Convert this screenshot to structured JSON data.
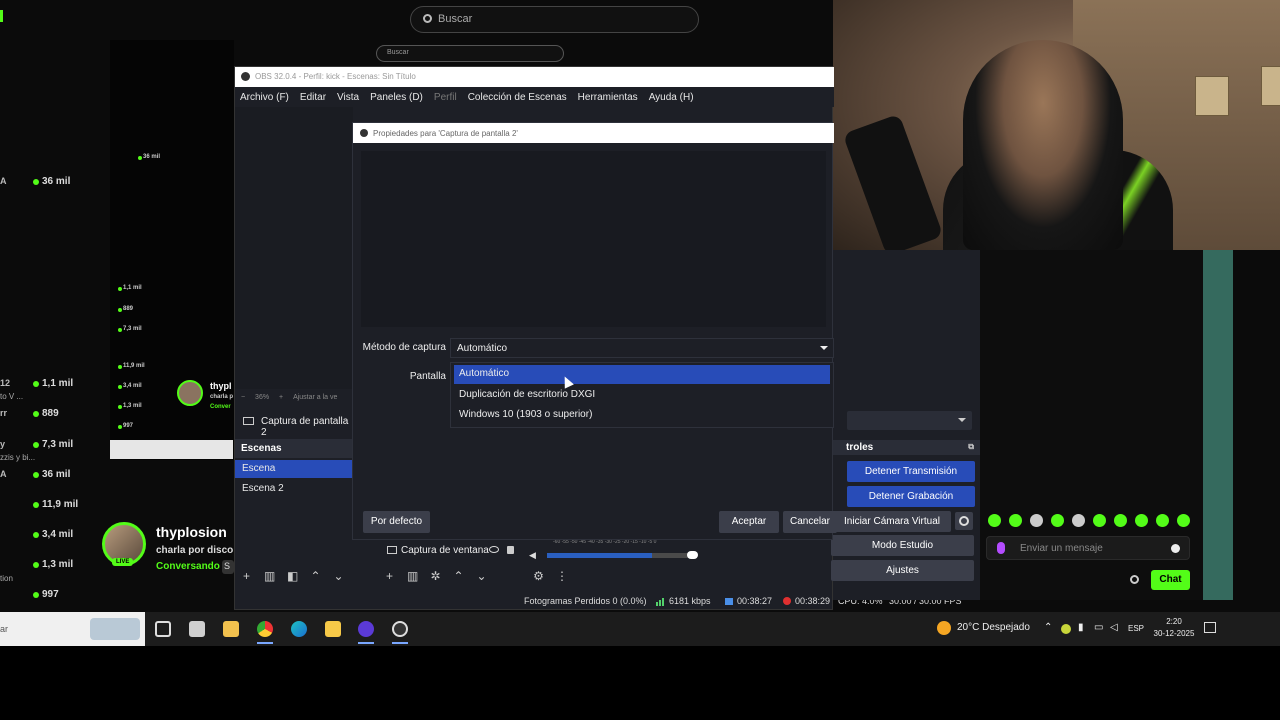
{
  "kick": {
    "search_placeholder": "Buscar",
    "search_placeholder_small": "Buscar",
    "viewers": [
      {
        "prefix": "A",
        "value": "36 mil"
      },
      {
        "prefix": "12",
        "value": "1,1 mil"
      },
      {
        "prefix": "rr",
        "value": "889"
      },
      {
        "prefix": "y",
        "value": "7,3 mil"
      },
      {
        "prefix": "A",
        "value": "36 mil"
      },
      {
        "prefix": "",
        "value": "11,9 mil"
      },
      {
        "prefix": "",
        "value": "3,4 mil"
      },
      {
        "prefix": "",
        "value": "1,3 mil"
      },
      {
        "prefix": "",
        "value": "997"
      }
    ],
    "viewer_side_labels": [
      "to V ...",
      "zzis y bi...",
      "tion"
    ],
    "mini_counts": [
      "36 mil",
      "1,1 mil",
      "889",
      "7,3 mil",
      "11,9 mil",
      "3,4 mil",
      "1,3 mil",
      "997"
    ],
    "mini_name": "thypl",
    "mini_sub": "charla p",
    "mini_status": "Conver",
    "streamer": {
      "name": "thyplosion",
      "title": "charla por disco",
      "status": "Conversando",
      "live": "LIVE",
      "tag": "S"
    },
    "chat": {
      "placeholder": "Enviar un mensaje",
      "send_label": "Chat"
    }
  },
  "obs": {
    "window_title": "OBS 32.0.4 - Perfil: kick - Escenas: Sin Título",
    "menu": [
      "Archivo (F)",
      "Editar",
      "Vista",
      "Paneles (D)",
      "Perfil",
      "Colección de Escenas",
      "Herramientas",
      "Ayuda (H)"
    ],
    "zoom_text": "36%",
    "zoom_fit": "Ajustar a la ve",
    "source_label": "Captura de pantalla 2",
    "scenes_header": "Escenas",
    "scenes": [
      "Escena",
      "Escena 2"
    ],
    "sources": [
      {
        "name": "Captura de ventana"
      }
    ],
    "mixer_ticks": "-60 -55 -50 -45 -40 -35 -30 -25 -20 -15 -10 -5 0",
    "controls": {
      "header": "troles",
      "buttons": [
        "Detener Transmisión",
        "Detener Grabación",
        "Iniciar Cámara Virtual",
        "Modo Estudio",
        "Ajustes"
      ]
    },
    "status": {
      "dropped": "Fotogramas Perdidos 0 (0.0%)",
      "bitrate": "6181 kbps",
      "stream_time": "00:38:27",
      "rec_time": "00:38:29",
      "cpu": "CPU: 4.0%",
      "fps": "30.00 / 30.00 FPS"
    }
  },
  "dialog": {
    "title": "Propiedades para 'Captura de pantalla 2'",
    "capture_method_label": "Método de captura",
    "capture_method_value": "Automático",
    "screen_label": "Pantalla",
    "options": [
      "Automático",
      "Duplicación de escritorio DXGI",
      "Windows 10 (1903 o superior)"
    ],
    "selected_option": 0,
    "defaults_button": "Por defecto",
    "ok_button": "Aceptar",
    "cancel_button": "Cancelar"
  },
  "taskbar": {
    "search_stub": "ar",
    "weather": "20°C  Despejado",
    "lang": "ESP",
    "time": "2:20",
    "date": "30-12-2025"
  },
  "colors": {
    "kick_green": "#53fc18",
    "obs_blue": "#284cb8",
    "obs_bg": "#1d1f26"
  }
}
